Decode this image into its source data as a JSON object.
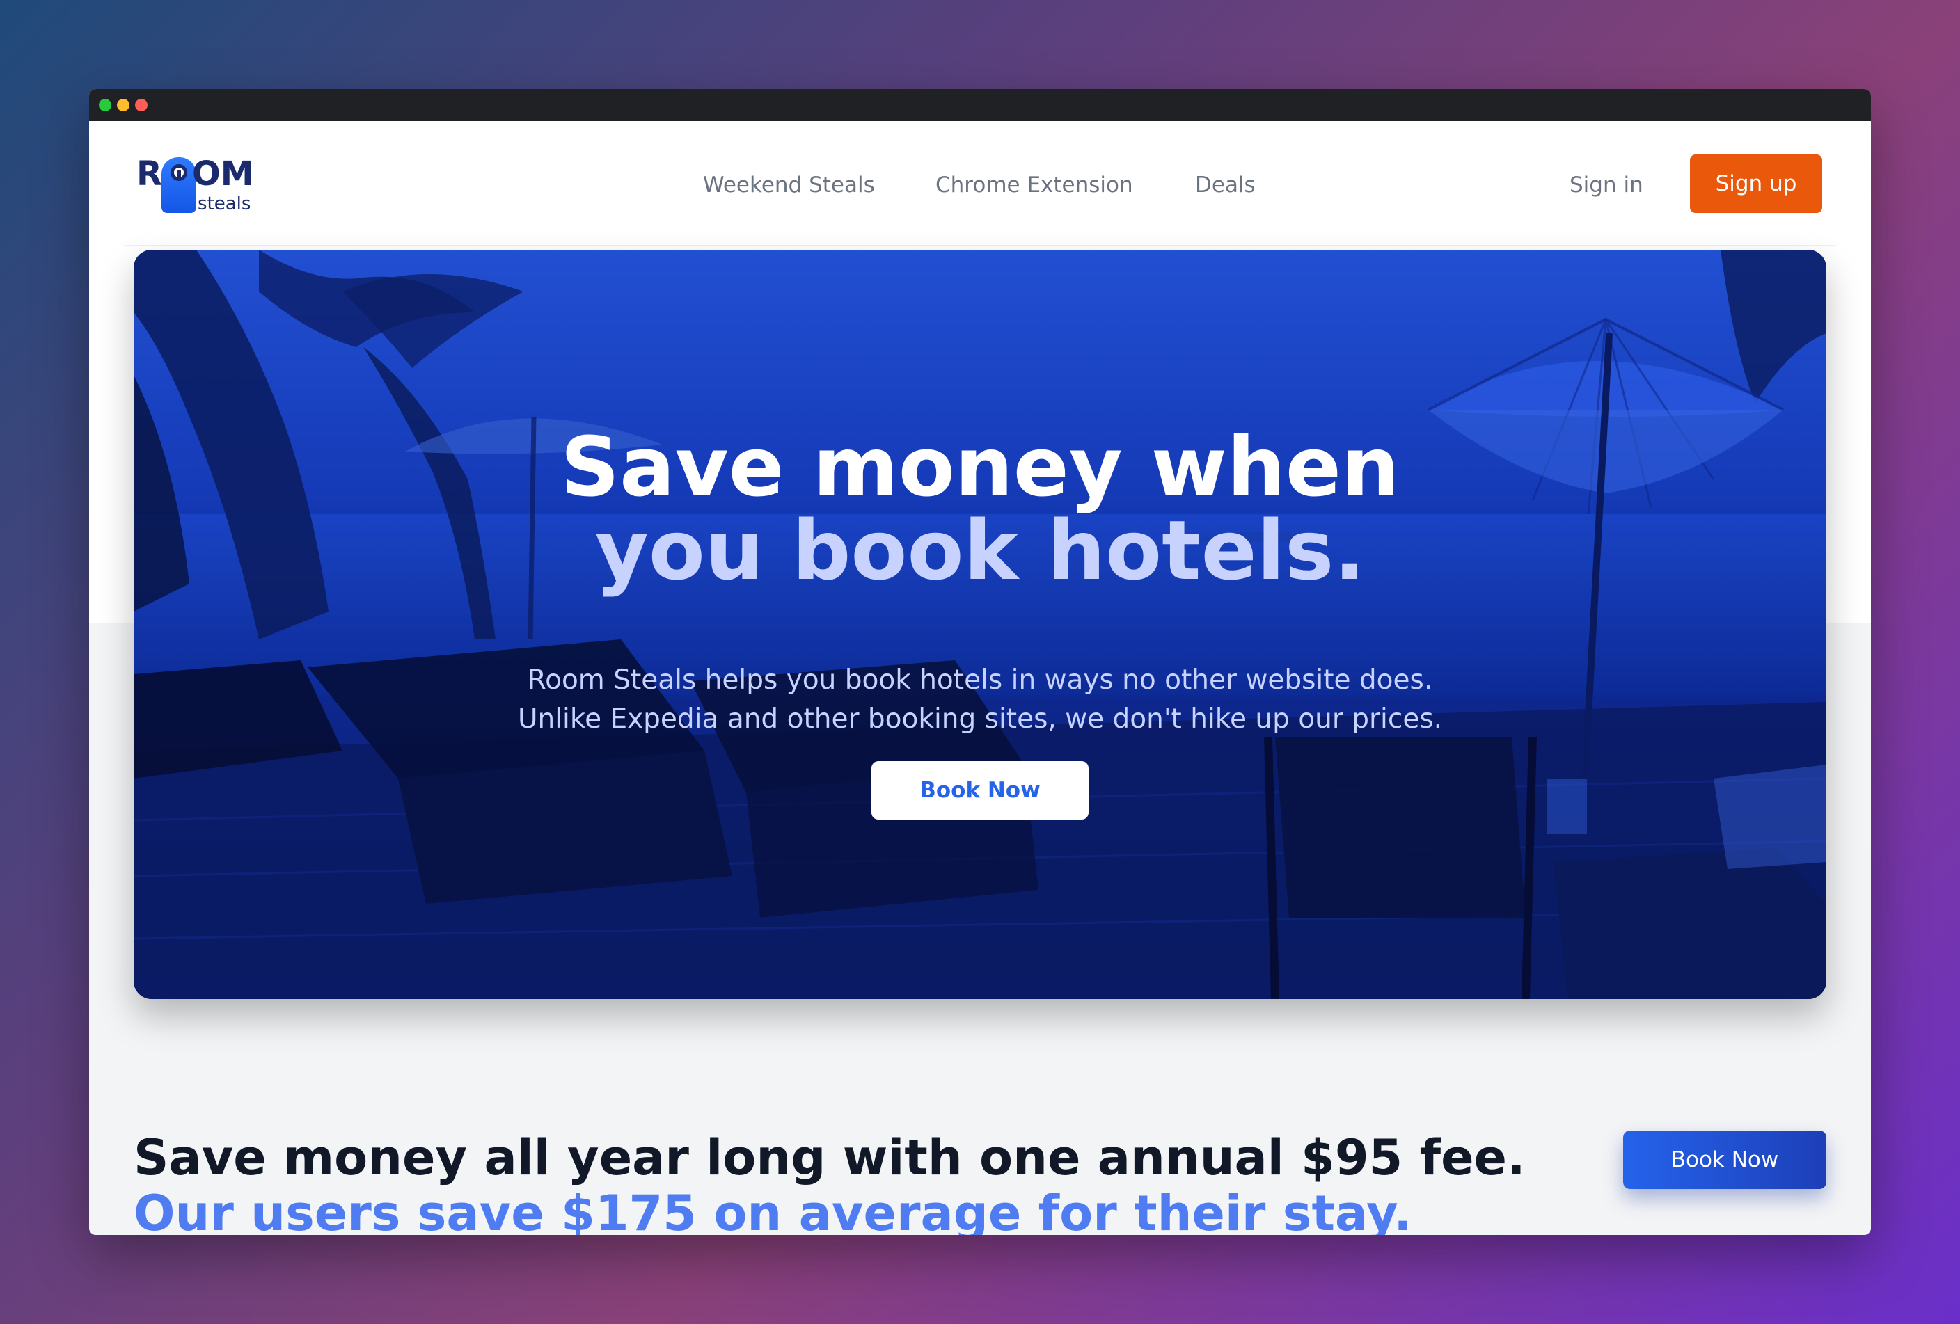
{
  "brand": {
    "logo_letters_left": "R",
    "logo_letters_right": "OM",
    "logo_sub": "steals"
  },
  "nav": {
    "items": [
      {
        "label": "Weekend Steals"
      },
      {
        "label": "Chrome Extension"
      },
      {
        "label": "Deals"
      }
    ],
    "sign_in": "Sign in",
    "sign_up": "Sign up"
  },
  "hero": {
    "title_line1": "Save money when",
    "title_line2": "you book hotels.",
    "subtitle_line1": "Room Steals helps you book hotels in ways no other website does.",
    "subtitle_line2": "Unlike Expedia and other booking sites, we don't hike up our prices.",
    "cta": "Book Now"
  },
  "cta_section": {
    "line1": "Save money all year long with one annual $95 fee.",
    "line2": "Our users save $175 on average for their stay.",
    "button": "Book Now"
  },
  "colors": {
    "accent_orange": "#ea580c",
    "accent_blue": "#2563eb",
    "headline_dark": "#111827",
    "headline_blue": "#4f7cf0"
  }
}
